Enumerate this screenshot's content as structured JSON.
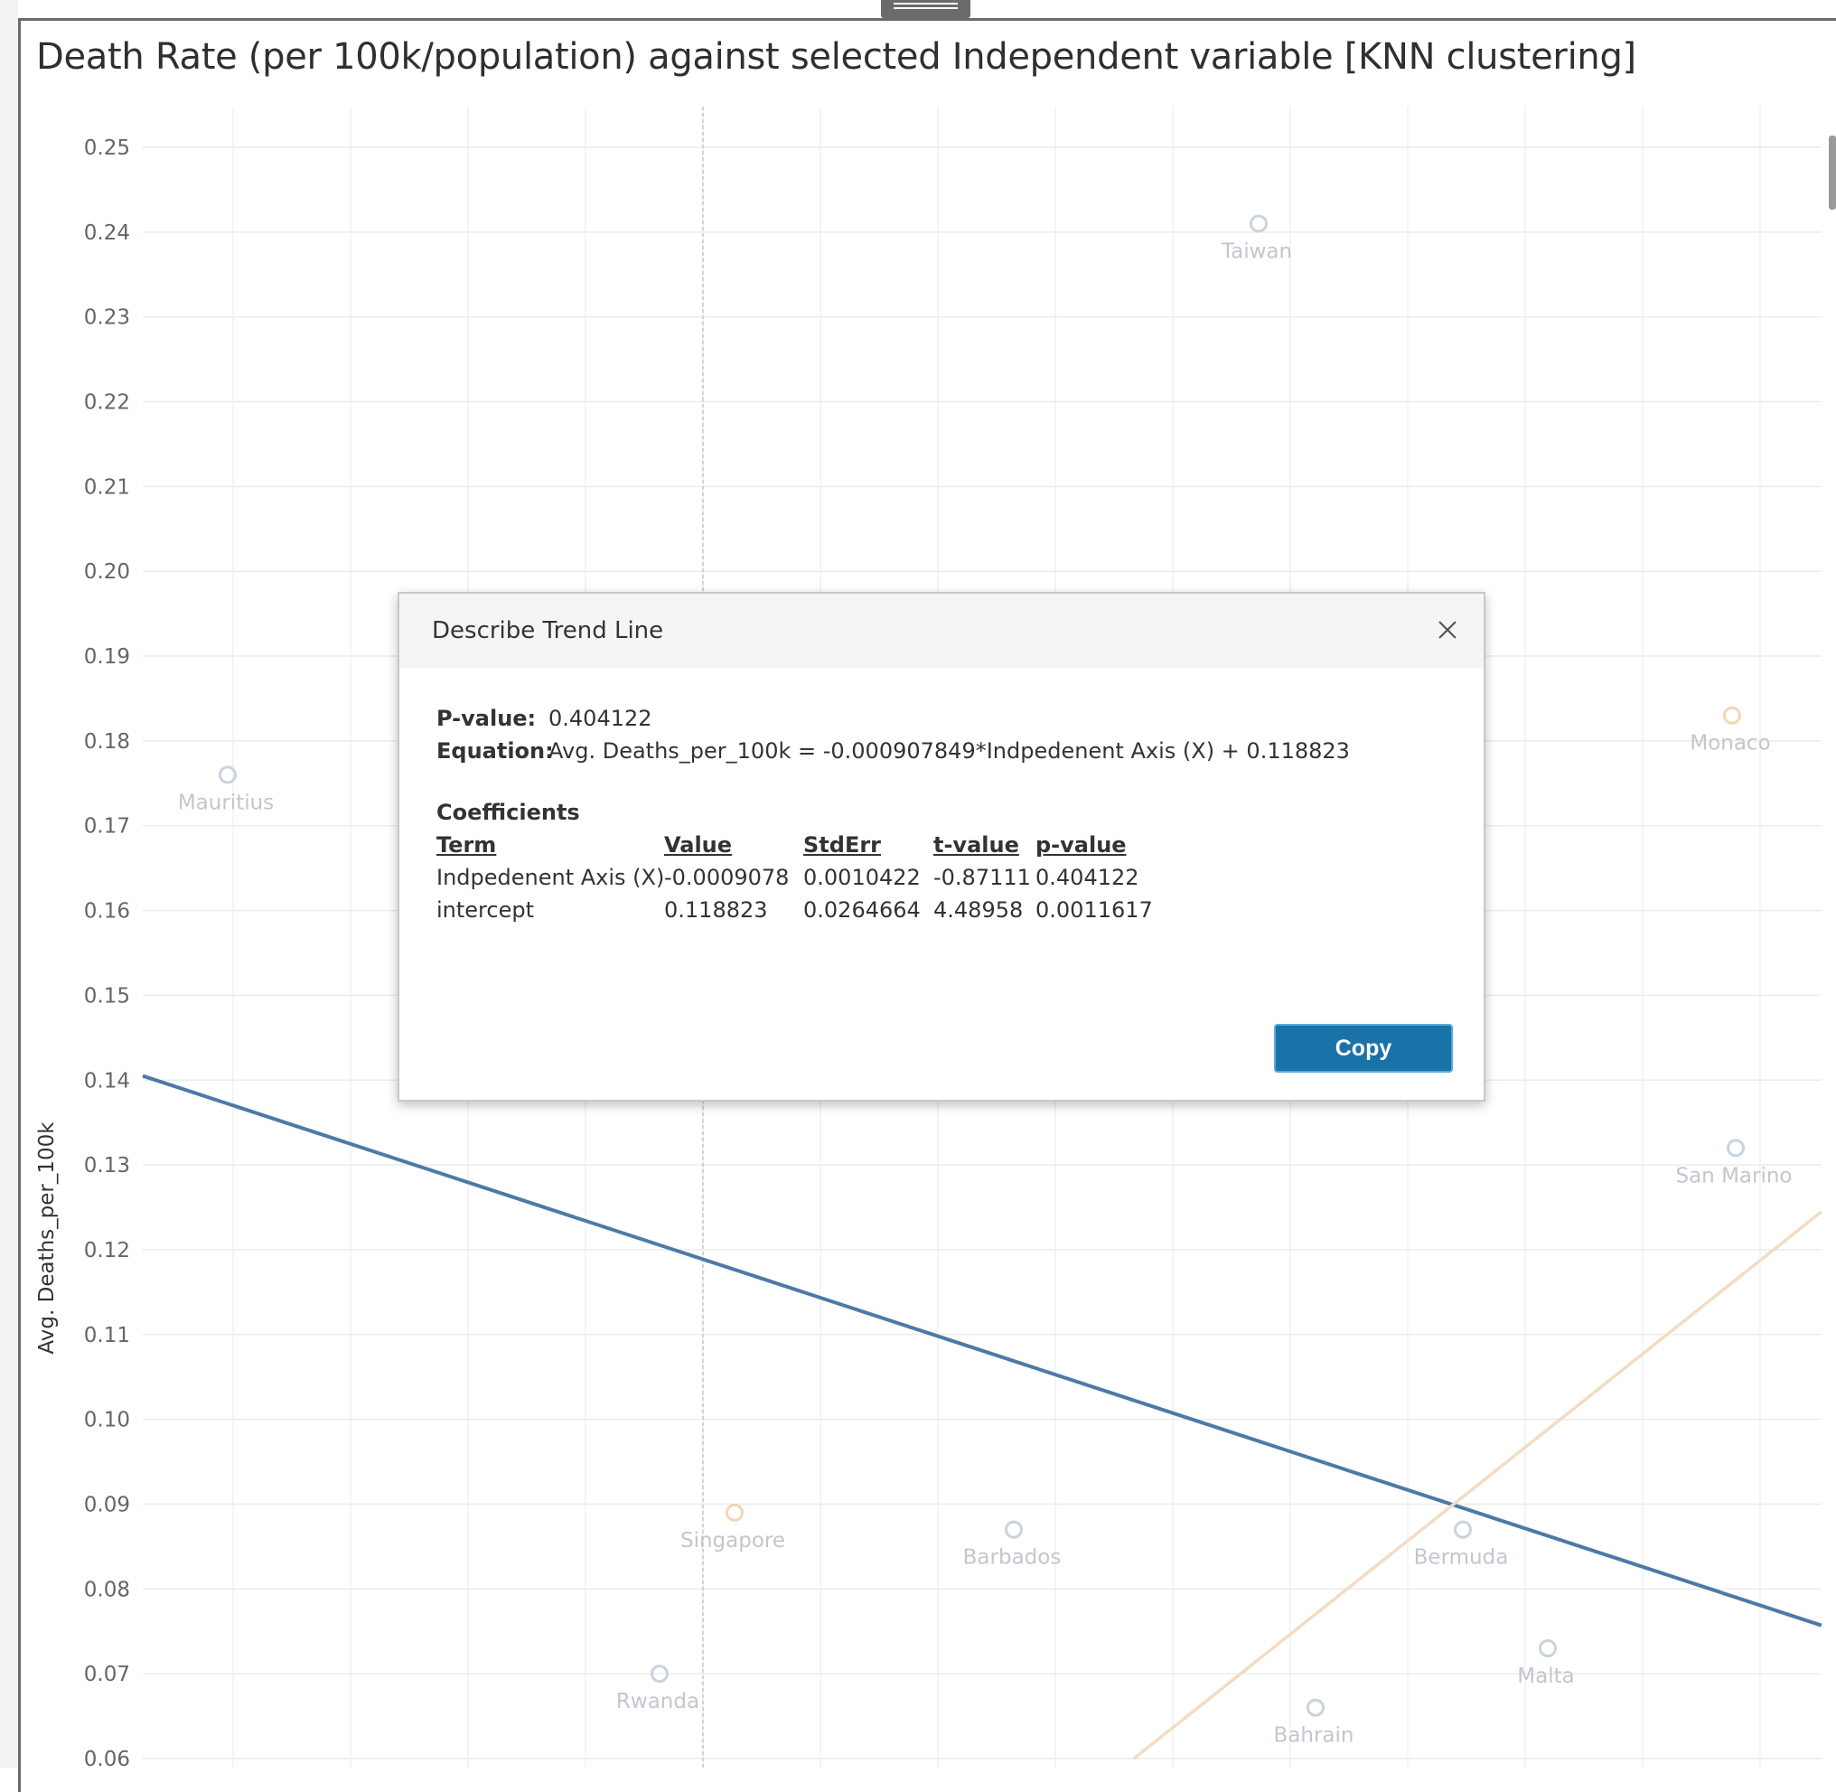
{
  "title": "Death Rate (per 100k/population) against selected Independent variable [KNN clustering]",
  "colors": {
    "trend": "#4e79a7",
    "trend2": "#f2dcc4",
    "point_blue": "#c9d3dc",
    "point_orange": "#f5d6b3",
    "button": "#1a73a8"
  },
  "chart_data": {
    "type": "scatter",
    "ylabel": "Avg. Deaths_per_100k",
    "ylim": [
      0.06,
      0.25
    ],
    "y_ticks": [
      "0.25",
      "0.24",
      "0.23",
      "0.22",
      "0.21",
      "0.20",
      "0.19",
      "0.18",
      "0.17",
      "0.16",
      "0.15",
      "0.14",
      "0.13",
      "0.12",
      "0.11",
      "0.10",
      "0.09",
      "0.08",
      "0.07",
      "0.06"
    ],
    "points": [
      {
        "label": "Taiwan",
        "y": 0.241,
        "cluster": "blue"
      },
      {
        "label": "Monaco",
        "y": 0.183,
        "cluster": "orange"
      },
      {
        "label": "Mauritius",
        "y": 0.176,
        "cluster": "blue"
      },
      {
        "label": "San Marino",
        "y": 0.132,
        "cluster": "blue"
      },
      {
        "label": "Singapore",
        "y": 0.089,
        "cluster": "orange"
      },
      {
        "label": "Barbados",
        "y": 0.087,
        "cluster": "blue"
      },
      {
        "label": "Bermuda",
        "y": 0.087,
        "cluster": "blue"
      },
      {
        "label": "Rwanda",
        "y": 0.07,
        "cluster": "blue"
      },
      {
        "label": "Malta",
        "y": 0.073,
        "cluster": "blue"
      },
      {
        "label": "Bahrain",
        "y": 0.066,
        "cluster": "blue"
      }
    ],
    "trend_lines": [
      {
        "name": "blue",
        "y_start": 0.1405,
        "y_end": 0.0757
      },
      {
        "name": "orange",
        "y_start": 0.06,
        "y_end": 0.1245
      }
    ]
  },
  "dialog": {
    "title": "Describe Trend Line",
    "pvalue_label": "P-value:",
    "pvalue": "0.404122",
    "equation_label": "Equation:",
    "equation": "Avg. Deaths_per_100k = -0.000907849*Indpedenent Axis (X) + 0.118823",
    "coefficients_label": "Coefficients",
    "headers": [
      "Term",
      "Value",
      "StdErr",
      "t-value",
      "p-value"
    ],
    "rows": [
      [
        "Indpedenent Axis (X)",
        "-0.0009078",
        "0.0010422",
        "-0.87111",
        "0.404122"
      ],
      [
        "intercept",
        "0.118823",
        "0.0264664",
        "4.48958",
        "0.0011617"
      ]
    ],
    "copy_label": "Copy"
  }
}
